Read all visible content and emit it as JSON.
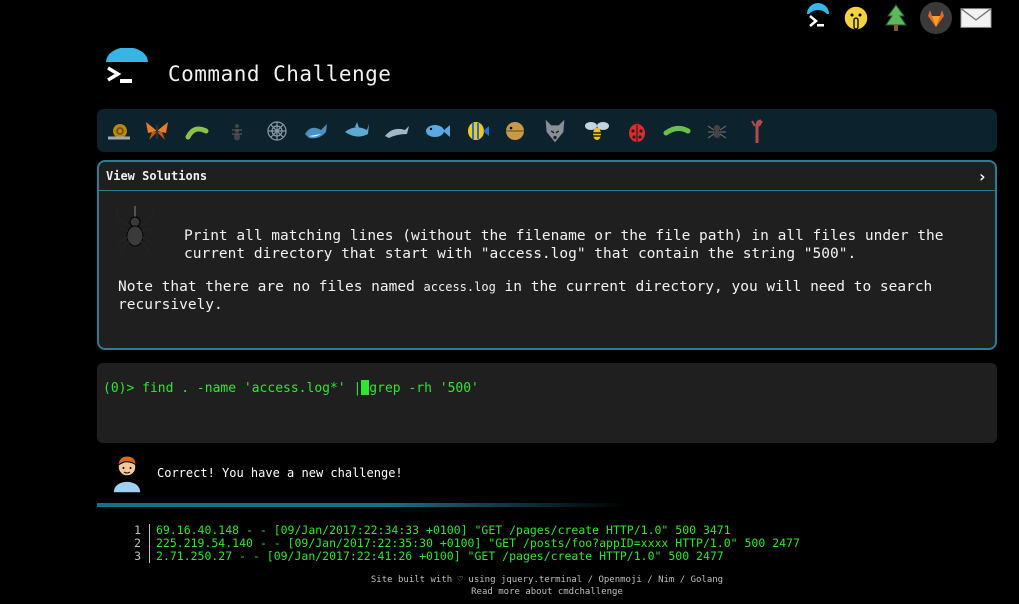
{
  "app": {
    "title": "Command Challenge"
  },
  "top_icons": [
    "terminal-icon",
    "shushing-face-icon",
    "tree-icon",
    "gitlab-icon",
    "mail-icon"
  ],
  "challenge_icons": [
    "snail-icon",
    "butterfly-icon",
    "bug-icon",
    "ant-icon",
    "web-icon",
    "whale-icon",
    "shark-icon",
    "dolphin-icon",
    "fish-icon",
    "tropical-fish-icon",
    "blowfish-icon",
    "wolf-icon",
    "bee-icon",
    "ladybug-icon",
    "cricket-icon",
    "spider-icon",
    "scorpion-icon"
  ],
  "panel": {
    "header": "View Solutions",
    "description": "Print all matching lines (without the filename or the file path) in all files under the current directory that start with \"access.log\" that contain the string \"500\".",
    "note_before": "Note that there are no files named ",
    "note_code": "access.log",
    "note_after": " in the current directory, you will need to search recursively."
  },
  "terminal": {
    "prompt": "(0)> ",
    "before_cursor": "find . -name 'access.log*' |",
    "after_cursor": "grep -rh '500'"
  },
  "result": {
    "message": "Correct! You have a new challenge!"
  },
  "output_lines": [
    {
      "n": "1",
      "text": "69.16.40.148 - - [09/Jan/2017:22:34:33 +0100] \"GET /pages/create HTTP/1.0\" 500 3471"
    },
    {
      "n": "2",
      "text": "225.219.54.140 - - [09/Jan/2017:22:35:30 +0100] \"GET /posts/foo?appID=xxxx HTTP/1.0\" 500 2477"
    },
    {
      "n": "3",
      "text": "2.71.250.27 - - [09/Jan/2017:22:41:26 +0100] \"GET /pages/create HTTP/1.0\" 500 2477"
    }
  ],
  "footer": {
    "line1": "Site built with ♡ using jquery.terminal / Openmoji / Nim / Golang",
    "line2": "Read more about cmdchallenge"
  },
  "colors": {
    "accent": "#2b7d96",
    "terminal_green": "#2ee62e",
    "bar_bg": "#0c232d",
    "panel_bg": "#1f1f1f"
  }
}
